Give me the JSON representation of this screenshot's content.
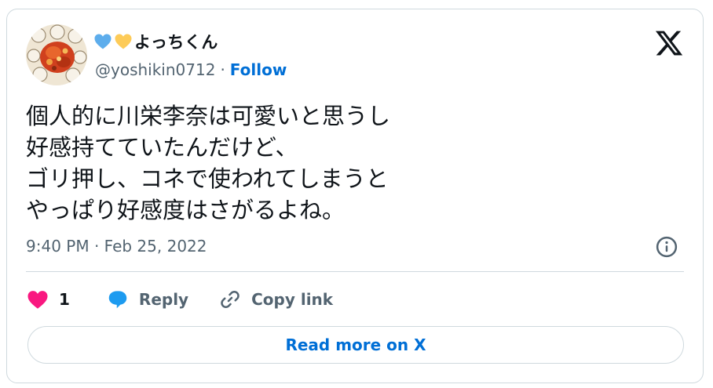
{
  "author": {
    "display_name_emojis": [
      "blue-heart-emoji",
      "yellow-heart-emoji"
    ],
    "display_name": "よっちくん",
    "handle": "@yoshikin0712",
    "separator": "·",
    "follow_label": "Follow"
  },
  "tweet": {
    "lines": [
      "個人的に川栄李奈は可愛いと思うし",
      "好感持てていたんだけど、",
      "ゴリ押し、コネで使われてしまうと",
      "やっぱり好感度はさがるよね。"
    ],
    "timestamp": "9:40 PM · Feb 25, 2022"
  },
  "actions": {
    "like_count": "1",
    "reply_label": "Reply",
    "copy_link_label": "Copy link"
  },
  "read_more_label": "Read more on X",
  "colors": {
    "link_blue": "#006fd6",
    "like_pink": "#f91880",
    "reply_blue": "#1d9bf0",
    "muted_text": "#536471",
    "border": "#cfd9de"
  }
}
